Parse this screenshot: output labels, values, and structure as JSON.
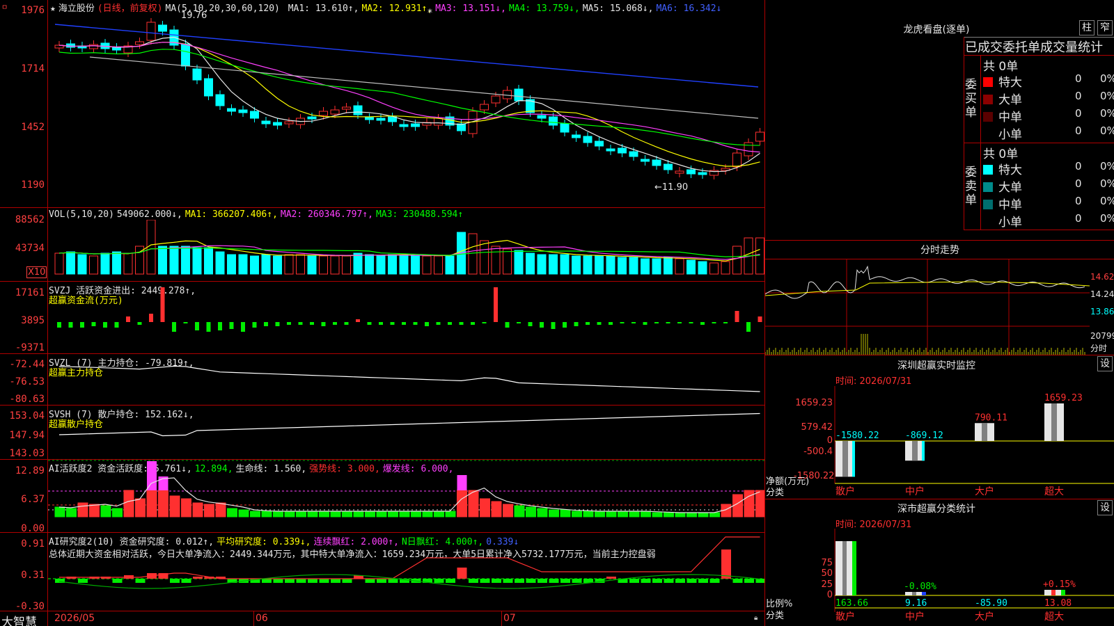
{
  "app": {
    "logo_text": "大智慧",
    "corner_mark": "ㅁ"
  },
  "main": {
    "star": "★",
    "stock_name": "海立股份",
    "period": "(日线，前复权)",
    "ma_params": "MA(5,10,20,30,60,120)",
    "ma1": "MA1: 13.610↑,",
    "ma2": "MA2: 12.931↑,",
    "ma3": "MA3: 13.151↓,",
    "ma4": "MA4: 13.759↓,",
    "ma5": "MA5: 15.068↓,",
    "ma6": "MA6: 16.342↓",
    "y_labels": [
      "1976",
      "1714",
      "1452",
      "1190"
    ],
    "high_mark": "19.76",
    "low_mark": "←11.90",
    "star_mark": "*"
  },
  "vol": {
    "legend": "VOL(5,10,20)",
    "value": "549062.000↓,",
    "ma1": "MA1: 366207.406↑,",
    "ma2": "MA2: 260346.797↑,",
    "ma3": "MA3: 230488.594↑",
    "y_labels": [
      "88562",
      "43734"
    ],
    "unit": "X10"
  },
  "svzj": {
    "legend": "SVZJ  活跃资金进出: 2449.278↑,",
    "subtitle": "超赢资金流(万元)",
    "y_labels": [
      "17161",
      "3895",
      "-9371"
    ]
  },
  "svzl": {
    "legend": "SVZL (7) 主力持仓: -79.819↑,",
    "subtitle": "超赢主力持仓",
    "y_labels": [
      "-72.44",
      "-76.53",
      "-80.63"
    ]
  },
  "svsh": {
    "legend": "SVSH (7) 散户持仓: 152.162↓,",
    "subtitle": "超赢散户持仓",
    "y_labels": [
      "153.04",
      "147.94",
      "143.03"
    ]
  },
  "ai_active": {
    "l1": "AI活跃度2 资金活跃度: 5.761↓,",
    "l2": "12.894,",
    "l3": "生命线: 1.560,",
    "l4": "强势线: 3.000,",
    "l5": "爆发线: 6.000,",
    "y_labels": [
      "12.89",
      "6.37",
      "0.00"
    ]
  },
  "ai_research": {
    "l1": "AI研究度2(10) 资金研究度: 0.012↑,",
    "l2": "平均研究度: 0.339↓,",
    "l3": "连续飘红: 2.000↑,",
    "l4": "N日飘红: 4.000↑,",
    "l5": "0.339↓",
    "summary": "总体近期大资金相对活跃，今日大单净流入：2449.344万元，其中特大单净流入：1659.234万元，大单5日累计净入5732.177万元，当前主力控盘弱",
    "y_labels": [
      "0.91",
      "0.31",
      "-0.30"
    ]
  },
  "x_axis": {
    "labels": [
      "2026/05",
      "06",
      "07"
    ]
  },
  "dragon": {
    "title": "龙虎看盘(逐单)",
    "btn1": "柱",
    "btn2": "窄",
    "header": "已成交委托单成交量统计",
    "buy_label": "委买单",
    "sell_label": "委卖单",
    "buy_total": "共 0单",
    "sell_total": "共 0单",
    "rows": [
      {
        "name": "特大",
        "count": "0",
        "pct": "0%"
      },
      {
        "name": "大单",
        "count": "0",
        "pct": "0%"
      },
      {
        "name": "中单",
        "count": "0",
        "pct": "0%"
      },
      {
        "name": "小单",
        "count": "0",
        "pct": "0%"
      }
    ],
    "buy_colors": [
      "#ff0000",
      "#8b0000",
      "#5a0000",
      "#000000"
    ],
    "sell_colors": [
      "#00ffff",
      "#008b8b",
      "#006e6e",
      "#000000"
    ]
  },
  "intraday": {
    "title": "分时走势",
    "y_labels": [
      "14.62",
      "14.24",
      "13.86"
    ],
    "vol_label": "20799",
    "vol_unit": "分时"
  },
  "sz_monitor": {
    "title": "深圳超赢实时监控",
    "settings": "设",
    "time": "时间: 2026/07/31",
    "y_labels": [
      "1659.23",
      "579.42",
      "0",
      "-500.4",
      "-1580.22"
    ],
    "y_caption": "净额(万元)",
    "x_caption": "分类",
    "categories": [
      "散户",
      "中户",
      "大户",
      "超大"
    ],
    "values": [
      -1580.22,
      -869.12,
      790.11,
      1659.23
    ],
    "value_labels": [
      "-1580.22",
      "-869.12",
      "790.11",
      "1659.23"
    ]
  },
  "sz_class": {
    "title": "深市超赢分类统计",
    "settings": "设",
    "time": "时间: 2026/07/31",
    "y_labels": [
      "75",
      "50",
      "25",
      "0"
    ],
    "y_caption": "比例%",
    "x_caption": "分类",
    "categories": [
      "散户",
      "中户",
      "大户",
      "超大"
    ],
    "top_labels": [
      "",
      "-0.08%",
      "",
      "+0.15%"
    ],
    "bottom_labels": [
      "163.66",
      "9.16",
      "-85.90",
      "13.08"
    ]
  },
  "colors": {
    "up": "#ff3030",
    "down": "#00ffff",
    "grid": "#b00000"
  }
}
